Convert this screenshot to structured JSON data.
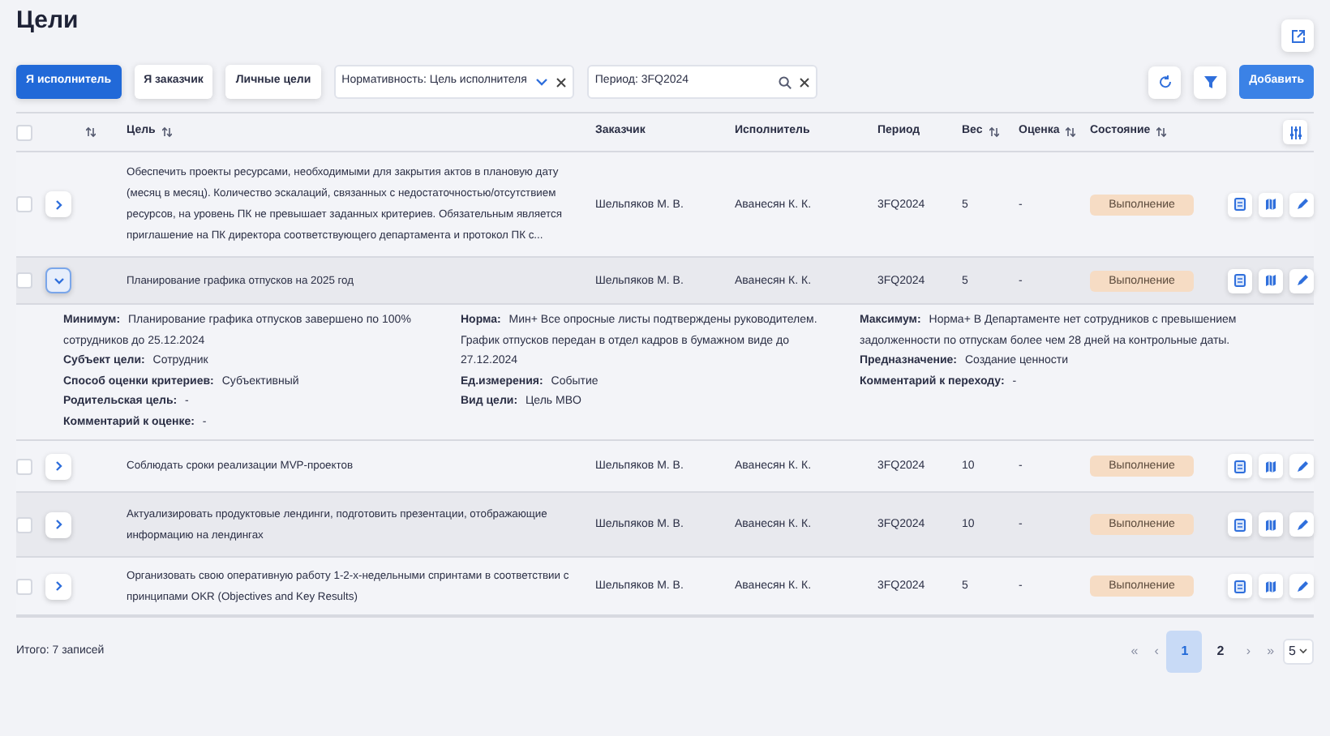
{
  "page": {
    "title": "Цели"
  },
  "toolbar": {
    "tabs": [
      {
        "label": "Я исполнитель",
        "selected": true
      },
      {
        "label": "Я заказчик",
        "selected": false
      },
      {
        "label": "Личные цели",
        "selected": false
      }
    ],
    "filters": [
      {
        "kind": "select",
        "value": "Нормативность: Цель исполнителя"
      },
      {
        "kind": "search",
        "value": "Период: 3FQ2024"
      }
    ],
    "add_button": "Добавить"
  },
  "table": {
    "columns": [
      {
        "sortable": true
      },
      {
        "label": "Цель",
        "sortable": true
      },
      {
        "label": "Заказчик",
        "sortable": false
      },
      {
        "label": "Исполнитель",
        "sortable": false
      },
      {
        "label": "Период",
        "sortable": false
      },
      {
        "label": "Вес",
        "sortable": true
      },
      {
        "label": "Оценка",
        "sortable": true
      },
      {
        "label": "Состояние",
        "sortable": true
      }
    ],
    "all_checked": false,
    "rows": [
      {
        "goal": "Обеспечить проекты ресурсами, необходимыми для закрытия актов в плановую дату (месяц в месяц). Количество эскалаций, связанных с недостаточностью/отсутствием ресурсов, на уровень ПК не превышает заданных критериев. Обязательным является приглашение на ПК директора соответствующего департамента и протокол ПК с...",
        "customer": "Шельпяков М. В.",
        "executor": "Аванесян К. К.",
        "period": "3FQ2024",
        "weight": "5",
        "score": "-",
        "status": "Выполнение",
        "checked": false,
        "expanded": false
      },
      {
        "goal": "Планирование графика отпусков на 2025 год",
        "customer": "Шельпяков М. В.",
        "executor": "Аванесян К. К.",
        "period": "3FQ2024",
        "weight": "5",
        "score": "-",
        "status": "Выполнение",
        "checked": false,
        "expanded": true,
        "details": [
          [
            "**Минимум:** Планирование графика отпусков завершено по 100% сотрудников до 25.12.2024",
            "**Субъект цели:** Сотрудник",
            "**Способ оценки критериев:** Субъективный",
            "**Родительская цель:** -",
            "**Комментарий к оценке:** -"
          ],
          [
            "**Норма:** Мин+ Все опросные листы подтверждены руководителем. График отпусков передан в отдел кадров в бумажном виде до 27.12.2024",
            "**Ед.измерения:** Событие",
            "**Вид цели:** Цель MBO"
          ],
          [
            "**Максимум:** Норма+ В Департаменте нет сотрудников с превышением задолженности по отпускам более чем 28 дней на контрольные даты.",
            "**Предназначение:** Создание ценности",
            "**Комментарий к переходу:** -"
          ]
        ]
      },
      {
        "goal": "Соблюдать сроки реализации MVP-проектов",
        "customer": "Шельпяков М. В.",
        "executor": "Аванесян К. К.",
        "period": "3FQ2024",
        "weight": "10",
        "score": "-",
        "status": "Выполнение",
        "checked": false,
        "expanded": false
      },
      {
        "goal": "Актуализировать продуктовые лендинги, подготовить презентации, отображающие информацию на лендингах",
        "customer": "Шельпяков М. В.",
        "executor": "Аванесян К. К.",
        "period": "3FQ2024",
        "weight": "10",
        "score": "-",
        "status": "Выполнение",
        "checked": false,
        "expanded": false
      },
      {
        "goal": "Организовать свою оперативную работу 1-2-х-недельными спринтами в соответствии с принципами OKR (Objectives and Key Results)",
        "customer": "Шельпяков М. В.",
        "executor": "Аванесян К. К.",
        "period": "3FQ2024",
        "weight": "5",
        "score": "-",
        "status": "Выполнение",
        "checked": false,
        "expanded": false
      }
    ]
  },
  "footer": {
    "total": "Итого: 7 записей",
    "first": "«",
    "prev": "‹",
    "pages": [
      {
        "label": "1",
        "selected": true
      },
      {
        "label": "2",
        "selected": false
      }
    ],
    "next": "›",
    "last": "»",
    "page_size": "5"
  }
}
